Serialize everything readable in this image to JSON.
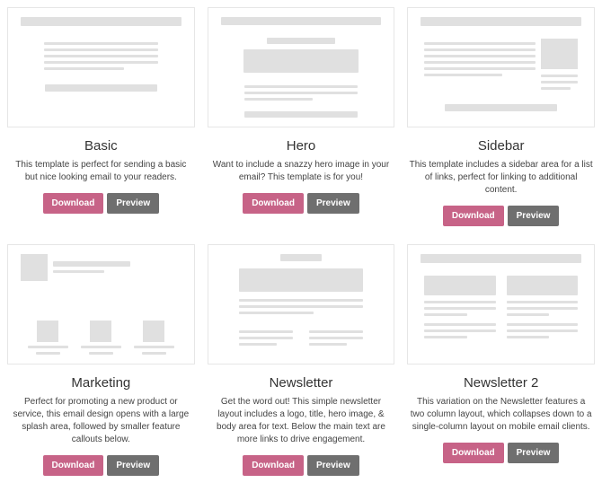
{
  "labels": {
    "download": "Download",
    "preview": "Preview"
  },
  "templates": [
    {
      "name": "Basic",
      "desc": "This template is perfect for sending a basic but nice looking email to your readers.",
      "thumb": "basic"
    },
    {
      "name": "Hero",
      "desc": "Want to include a snazzy hero image in your email? This template is for you!",
      "thumb": "hero"
    },
    {
      "name": "Sidebar",
      "desc": "This template includes a sidebar area for a list of links, perfect for linking to additional content.",
      "thumb": "sidebar"
    },
    {
      "name": "Marketing",
      "desc": "Perfect for promoting a new product or service, this email design opens with a large splash area, followed by smaller feature callouts below.",
      "thumb": "marketing"
    },
    {
      "name": "Newsletter",
      "desc": "Get the word out! This simple newsletter layout includes a logo, title, hero image, & body area for text. Below the main text are more links to drive engagement.",
      "thumb": "newsletter"
    },
    {
      "name": "Newsletter 2",
      "desc": "This variation on the Newsletter features a two column layout, which collapses down to a single-column layout on mobile email clients.",
      "thumb": "newsletter2"
    }
  ]
}
